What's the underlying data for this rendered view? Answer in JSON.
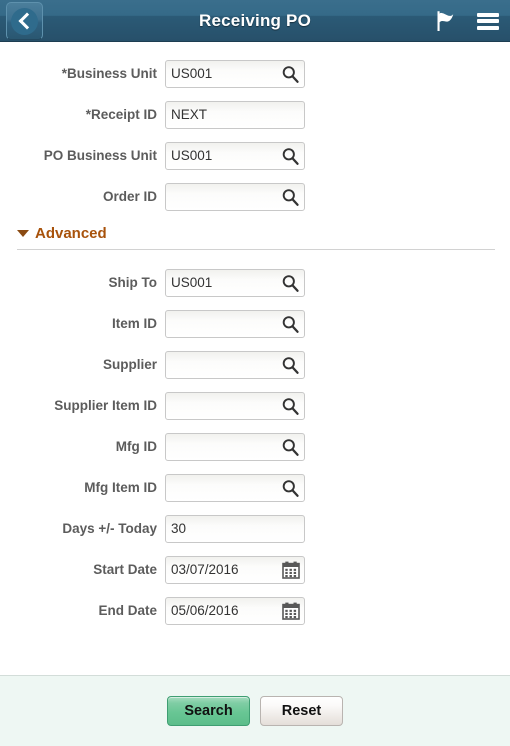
{
  "header": {
    "title": "Receiving PO",
    "back_icon": "back-chevron-icon",
    "flag_icon": "flag-icon",
    "menu_icon": "hamburger-menu-icon"
  },
  "form": {
    "primary_fields": [
      {
        "label": "*Business Unit",
        "value": "US001",
        "placeholder": "",
        "control": "lookup"
      },
      {
        "label": "*Receipt ID",
        "value": "NEXT",
        "placeholder": "",
        "control": "plain"
      },
      {
        "label": "PO Business Unit",
        "value": "US001",
        "placeholder": "",
        "control": "lookup"
      },
      {
        "label": "Order ID",
        "value": "",
        "placeholder": "",
        "control": "lookup"
      }
    ],
    "advanced": {
      "label": "Advanced",
      "expanded": true,
      "toggle_icon": "triangle-down-icon",
      "color": "#a8520b",
      "fields": [
        {
          "label": "Ship To",
          "value": "US001",
          "placeholder": "",
          "control": "lookup"
        },
        {
          "label": "Item ID",
          "value": "",
          "placeholder": "",
          "control": "lookup"
        },
        {
          "label": "Supplier",
          "value": "",
          "placeholder": "",
          "control": "lookup"
        },
        {
          "label": "Supplier Item ID",
          "value": "",
          "placeholder": "",
          "control": "lookup"
        },
        {
          "label": "Mfg ID",
          "value": "",
          "placeholder": "",
          "control": "lookup"
        },
        {
          "label": "Mfg Item ID",
          "value": "",
          "placeholder": "",
          "control": "lookup"
        },
        {
          "label": "Days +/- Today",
          "value": "30",
          "placeholder": "",
          "control": "plain"
        },
        {
          "label": "Start Date",
          "value": "03/07/2016",
          "placeholder": "",
          "control": "calendar"
        },
        {
          "label": "End Date",
          "value": "05/06/2016",
          "placeholder": "",
          "control": "calendar"
        }
      ]
    }
  },
  "footer": {
    "search_label": "Search",
    "reset_label": "Reset",
    "search_color": "#68c694"
  }
}
